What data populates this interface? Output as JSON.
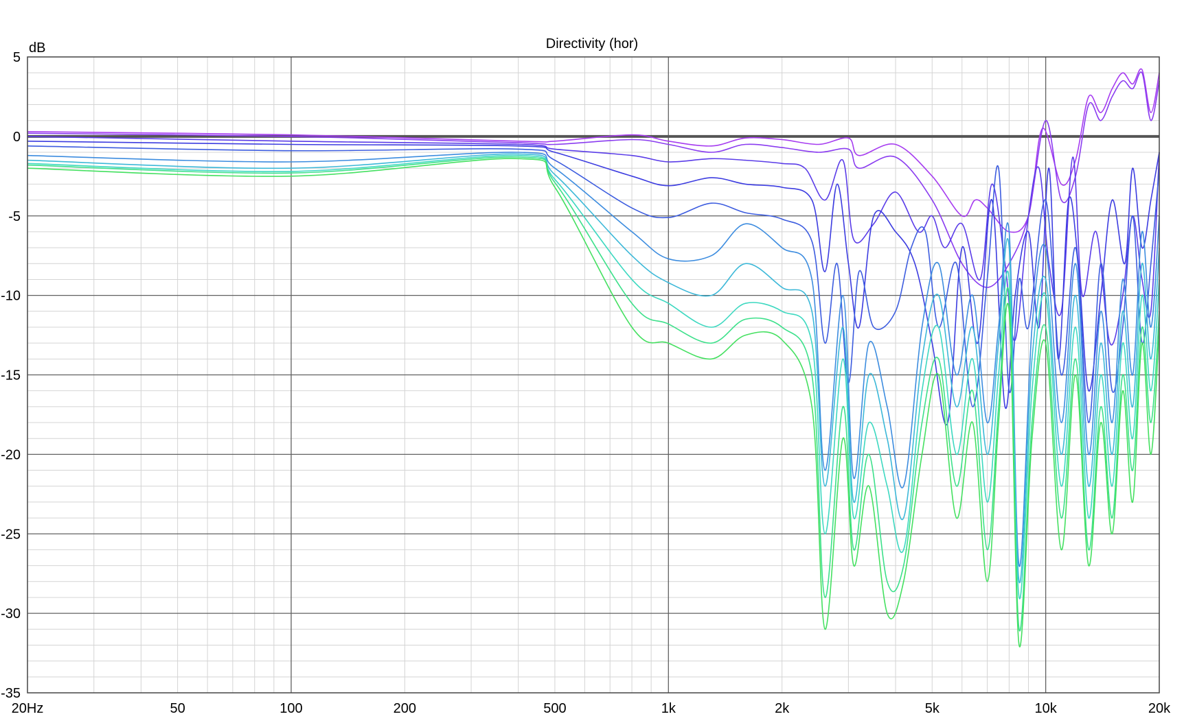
{
  "chart_data": {
    "type": "line",
    "title": "Directivity (hor)",
    "ylabel": "dB",
    "xlabel": "",
    "x_scale": "log",
    "xlim": [
      20,
      20000
    ],
    "ylim": [
      -35,
      5
    ],
    "grid": true,
    "x_ticks": [
      {
        "value": 20,
        "label": "20Hz"
      },
      {
        "value": 50,
        "label": "50"
      },
      {
        "value": 100,
        "label": "100"
      },
      {
        "value": 200,
        "label": "200"
      },
      {
        "value": 500,
        "label": "500"
      },
      {
        "value": 1000,
        "label": "1k"
      },
      {
        "value": 2000,
        "label": "2k"
      },
      {
        "value": 5000,
        "label": "5k"
      },
      {
        "value": 10000,
        "label": "10k"
      },
      {
        "value": 20000,
        "label": "20k"
      }
    ],
    "y_ticks": [
      {
        "value": 5,
        "label": "5"
      },
      {
        "value": 0,
        "label": "0"
      },
      {
        "value": -5,
        "label": "-5"
      },
      {
        "value": -10,
        "label": "-10"
      },
      {
        "value": -15,
        "label": "-15"
      },
      {
        "value": -20,
        "label": "-20"
      },
      {
        "value": -25,
        "label": "-25"
      },
      {
        "value": -30,
        "label": "-30"
      },
      {
        "value": -35,
        "label": "-35"
      }
    ],
    "series": [
      {
        "color": "#555555",
        "width": 4,
        "x": [
          20,
          20000
        ],
        "y": [
          0,
          0
        ]
      },
      {
        "color": "#a63cf0",
        "x": [
          20,
          100,
          400,
          500,
          800,
          1000,
          1300,
          1600,
          2000,
          2500,
          3000,
          3200,
          4000,
          5000,
          6000,
          6500,
          7000,
          8000,
          9000,
          9800,
          11000,
          12000,
          13000,
          14000,
          15000,
          16000,
          17000,
          18000,
          19000,
          20000
        ],
        "y": [
          0.3,
          0.1,
          -0.3,
          -0.3,
          0.1,
          -0.3,
          -0.6,
          -0.1,
          -0.2,
          -0.5,
          -0.1,
          -1.2,
          -0.5,
          -2.5,
          -5,
          -4,
          -4.5,
          -6,
          -5,
          0.5,
          -3,
          -1.5,
          2.5,
          1.5,
          3,
          4,
          3.3,
          4.2,
          1.5,
          4
        ]
      },
      {
        "color": "#8a3cf0",
        "x": [
          20,
          100,
          400,
          500,
          800,
          1000,
          1300,
          1600,
          2000,
          2500,
          3000,
          3200,
          4000,
          5000,
          6000,
          7000,
          8000,
          9000,
          10000,
          11000,
          12000,
          13000,
          14000,
          15000,
          16000,
          17000,
          18000,
          19000,
          20000
        ],
        "y": [
          0.2,
          0,
          -0.4,
          -0.5,
          -0.2,
          -0.5,
          -1.0,
          -0.5,
          -0.7,
          -1,
          -0.8,
          -2,
          -1.3,
          -4,
          -8,
          -9.5,
          -8,
          -5,
          1,
          -4,
          -2.5,
          2,
          1,
          2.5,
          3.5,
          3,
          4,
          1,
          3.5
        ]
      },
      {
        "color": "#5a3ce8",
        "x": [
          20,
          100,
          400,
          500,
          800,
          1000,
          1300,
          1600,
          2000,
          2300,
          2600,
          2900,
          3100,
          3500,
          4000,
          4600,
          5000,
          5400,
          6000,
          6700,
          7200,
          7800,
          8300,
          9000,
          9600,
          10200,
          11000,
          11800,
          12500,
          13600,
          14800,
          16000,
          17000,
          18000,
          19000,
          20000
        ],
        "y": [
          0,
          -0.3,
          -0.5,
          -0.8,
          -1.2,
          -1.6,
          -1.4,
          -1.5,
          -1.7,
          -2,
          -4,
          -1.5,
          -6.5,
          -5.5,
          -3.5,
          -6,
          -5,
          -7,
          -5.5,
          -9,
          -3,
          -8,
          -12.8,
          -5,
          -2,
          -8,
          -11,
          -1.3,
          -10,
          -6,
          -13,
          -10,
          -5,
          -9,
          -11,
          -1
        ]
      },
      {
        "color": "#3c3ce0",
        "x": [
          20,
          100,
          400,
          500,
          800,
          1000,
          1300,
          1600,
          2000,
          2400,
          2600,
          2800,
          3000,
          3200,
          3500,
          4000,
          4500,
          5000,
          5500,
          6000,
          6600,
          7200,
          7800,
          8300,
          9000,
          9600,
          10200,
          10800,
          11500,
          12200,
          13000,
          14000,
          15000,
          16200,
          17000,
          18000,
          19000,
          20000
        ],
        "y": [
          -0.3,
          -0.5,
          -0.6,
          -1,
          -2.5,
          -3.1,
          -2.6,
          -3,
          -3.2,
          -4,
          -8.5,
          -3,
          -8,
          -12,
          -5,
          -6,
          -8,
          -13,
          -18,
          -7,
          -13,
          -4,
          -17,
          -10,
          -6,
          -12,
          -2,
          -14,
          -4,
          -8,
          -16,
          -10,
          -4,
          -8,
          -2,
          -7,
          -4,
          -1
        ]
      },
      {
        "color": "#3c5cdf",
        "x": [
          20,
          100,
          400,
          500,
          800,
          1000,
          1300,
          1600,
          2000,
          2400,
          2600,
          2800,
          3000,
          3200,
          3500,
          4000,
          4400,
          4800,
          5200,
          5800,
          6400,
          7000,
          7500,
          8000,
          8500,
          9000,
          10000,
          11000,
          12000,
          13000,
          14000,
          15000,
          16000,
          17000,
          18000,
          19000,
          20000
        ],
        "y": [
          -0.6,
          -0.9,
          -0.8,
          -1.5,
          -4.5,
          -5.1,
          -4.2,
          -4.8,
          -5.2,
          -6.6,
          -13,
          -8,
          -15.5,
          -8.5,
          -12,
          -11,
          -7,
          -6,
          -12,
          -8,
          -17,
          -9,
          -2,
          -16,
          -9,
          -12,
          -4,
          -15,
          -7,
          -18,
          -8,
          -16,
          -12,
          -5,
          -13,
          -8,
          -2
        ]
      },
      {
        "color": "#3c8cdf",
        "x": [
          20,
          100,
          400,
          500,
          800,
          1000,
          1300,
          1600,
          2000,
          2400,
          2600,
          2900,
          3100,
          3400,
          3800,
          4200,
          4700,
          5200,
          5800,
          6400,
          7000,
          7500,
          8000,
          8500,
          9200,
          10000,
          11000,
          12000,
          13000,
          14000,
          15000,
          16000,
          17000,
          18000,
          19000,
          20000
        ],
        "y": [
          -1.2,
          -1.6,
          -1.0,
          -2.0,
          -6.0,
          -7.7,
          -7.5,
          -5.5,
          -7,
          -9,
          -21,
          -10,
          -21.5,
          -13,
          -17,
          -22,
          -12,
          -8,
          -15,
          -10,
          -18,
          -12,
          -6,
          -27,
          -12,
          -7,
          -18,
          -8,
          -20,
          -11,
          -18,
          -9,
          -15,
          -6,
          -12,
          -5
        ]
      },
      {
        "color": "#3cb8d8",
        "x": [
          20,
          100,
          400,
          500,
          800,
          1000,
          1300,
          1600,
          2000,
          2400,
          2600,
          2900,
          3100,
          3400,
          3800,
          4200,
          4700,
          5200,
          5800,
          6400,
          7000,
          7500,
          8000,
          8500,
          9200,
          10000,
          11000,
          12000,
          13000,
          14000,
          15000,
          16000,
          17000,
          18000,
          19000,
          20000
        ],
        "y": [
          -1.5,
          -2.0,
          -1.1,
          -2.4,
          -7.5,
          -9.2,
          -10,
          -8,
          -9.5,
          -11,
          -22,
          -12,
          -23,
          -15,
          -19,
          -24,
          -14,
          -10,
          -17,
          -12,
          -20,
          -13,
          -7,
          -28,
          -14,
          -9,
          -20,
          -10,
          -22,
          -13,
          -20,
          -11,
          -17,
          -8,
          -14,
          -7
        ]
      },
      {
        "color": "#3cd8c0",
        "x": [
          20,
          100,
          400,
          500,
          800,
          1000,
          1300,
          1600,
          2000,
          2400,
          2600,
          2900,
          3100,
          3400,
          3800,
          4200,
          4700,
          5200,
          5800,
          6400,
          7000,
          7500,
          8000,
          8500,
          9200,
          10000,
          11000,
          12000,
          13000,
          14000,
          15000,
          16000,
          17000,
          18000,
          19000,
          20000
        ],
        "y": [
          -1.7,
          -2.2,
          -1.2,
          -2.7,
          -9,
          -10.5,
          -12,
          -10.5,
          -11,
          -13,
          -25,
          -14,
          -24,
          -18,
          -22,
          -26,
          -16,
          -12,
          -20,
          -14,
          -23,
          -15,
          -9,
          -29,
          -16,
          -10,
          -22,
          -12,
          -24,
          -15,
          -22,
          -13,
          -19,
          -10,
          -16,
          -9
        ]
      },
      {
        "color": "#3ce08a",
        "x": [
          20,
          100,
          400,
          500,
          800,
          1000,
          1300,
          1600,
          2000,
          2400,
          2600,
          2900,
          3100,
          3400,
          3800,
          4200,
          4700,
          5200,
          5800,
          6400,
          7000,
          7500,
          8000,
          8500,
          9200,
          10000,
          11000,
          12000,
          13000,
          14000,
          15000,
          16000,
          17000,
          18000,
          19000,
          20000
        ],
        "y": [
          -1.8,
          -2.3,
          -1.3,
          -2.9,
          -10.5,
          -11.8,
          -13,
          -11.5,
          -12,
          -15,
          -29,
          -17,
          -26,
          -20,
          -28,
          -27,
          -18,
          -14,
          -22,
          -16,
          -26,
          -17,
          -10,
          -31,
          -18,
          -12,
          -24,
          -14,
          -26,
          -17,
          -24,
          -15,
          -21,
          -12,
          -18,
          -11
        ]
      },
      {
        "color": "#44e060",
        "x": [
          20,
          100,
          400,
          500,
          800,
          1000,
          1300,
          1600,
          2000,
          2400,
          2600,
          2900,
          3100,
          3400,
          3800,
          4200,
          4700,
          5200,
          5800,
          6400,
          7000,
          7500,
          8000,
          8500,
          9200,
          10000,
          11000,
          12000,
          13000,
          14000,
          15000,
          16000,
          17000,
          18000,
          19000,
          20000
        ],
        "y": [
          -2.0,
          -2.5,
          -1.4,
          -3.2,
          -12,
          -13,
          -14,
          -12.5,
          -12.8,
          -17,
          -31,
          -19,
          -27,
          -22,
          -30,
          -28,
          -20,
          -15,
          -24,
          -18,
          -28,
          -18,
          -11,
          -32,
          -19,
          -13,
          -26,
          -15,
          -27,
          -18,
          -25,
          -16,
          -23,
          -13,
          -20,
          -12
        ]
      }
    ]
  }
}
